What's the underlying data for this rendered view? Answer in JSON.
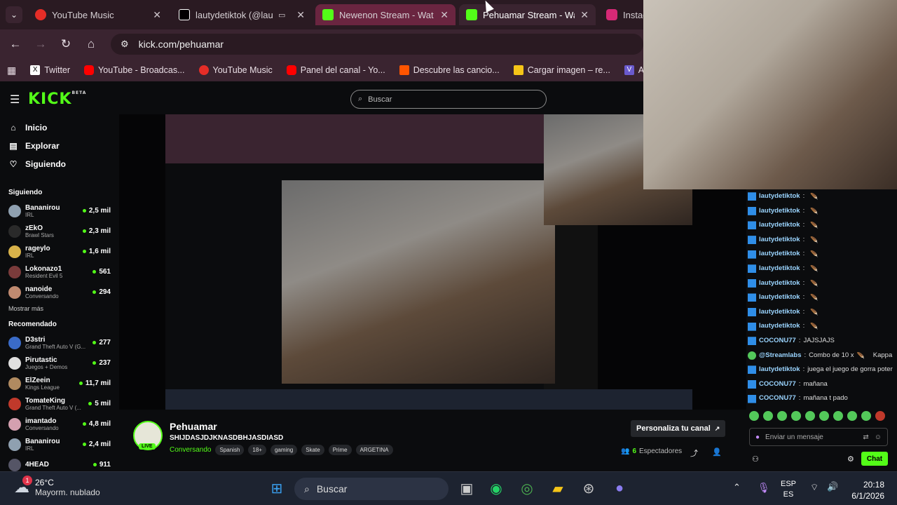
{
  "browser": {
    "tabs": [
      {
        "title": "YouTube Music",
        "icon": "youtube-music-icon",
        "color": "#e52d27"
      },
      {
        "title": "lautydetiktok (@lauty",
        "icon": "tiktok-icon",
        "color": "#ffffff"
      },
      {
        "title": "Newenon Stream - Watc",
        "icon": "kick-icon",
        "color": "#53fc18"
      },
      {
        "title": "Pehuamar Stream - Watc",
        "icon": "kick-icon",
        "color": "#53fc18"
      },
      {
        "title": "Instag",
        "icon": "instagram-icon",
        "color": "#d62976"
      }
    ],
    "url": "kick.com/pehuamar",
    "bookmarks": [
      {
        "label": "Twitter",
        "icon": "x-icon",
        "color": "#ffffff"
      },
      {
        "label": "YouTube - Broadcas...",
        "icon": "youtube-icon",
        "color": "#ff0000"
      },
      {
        "label": "YouTube Music",
        "icon": "youtube-music-icon",
        "color": "#e52d27"
      },
      {
        "label": "Panel del canal - Yo...",
        "icon": "youtube-icon",
        "color": "#ff0000"
      },
      {
        "label": "Descubre las cancio...",
        "icon": "soundcloud-icon",
        "color": "#ff5500"
      },
      {
        "label": "Cargar imagen – re...",
        "icon": "upload-icon",
        "color": "#f5c518"
      },
      {
        "label": "Aislar",
        "icon": "v-icon",
        "color": "#6a5acd"
      }
    ]
  },
  "kick": {
    "logo": "KICK",
    "logo_badge": "BETA",
    "search_placeholder": "Buscar",
    "nav": [
      {
        "label": "Inicio",
        "icon": "home-icon"
      },
      {
        "label": "Explorar",
        "icon": "browse-icon"
      },
      {
        "label": "Siguiendo",
        "icon": "heart-icon"
      }
    ],
    "following_title": "Siguiendo",
    "following": [
      {
        "name": "Bananirou",
        "category": "IRL",
        "viewers": "2,5 mil",
        "color": "#8fa0b0"
      },
      {
        "name": "zEkO",
        "category": "Brawl Stars",
        "viewers": "2,3 mil",
        "color": "#2a2a2a"
      },
      {
        "name": "rageylo",
        "category": "IRL",
        "viewers": "1,6 mil",
        "color": "#d8b24a"
      },
      {
        "name": "Lokonazo1",
        "category": "Resident Evil 5",
        "viewers": "561",
        "color": "#7a3b3b"
      },
      {
        "name": "nanoide",
        "category": "Conversando",
        "viewers": "294",
        "color": "#c08a70"
      }
    ],
    "show_more": "Mostrar más",
    "recommended_title": "Recomendado",
    "recommended": [
      {
        "name": "D3stri",
        "category": "Grand Theft Auto V (G...",
        "viewers": "277",
        "color": "#3a6bc8"
      },
      {
        "name": "Pirutastic",
        "category": "Juegos + Demos",
        "viewers": "237",
        "color": "#e0e0e0"
      },
      {
        "name": "ElZeein",
        "category": "Kings League",
        "viewers": "11,7 mil",
        "color": "#b08a60"
      },
      {
        "name": "TomateKing",
        "category": "Grand Theft Auto V (...",
        "viewers": "5 mil",
        "color": "#c0392b"
      },
      {
        "name": "imantado",
        "category": "Conversando",
        "viewers": "4,8 mil",
        "color": "#d4a0b0"
      },
      {
        "name": "Bananirou",
        "category": "IRL",
        "viewers": "2,4 mil",
        "color": "#8fa0b0"
      },
      {
        "name": "4HEAD",
        "category": "",
        "viewers": "911",
        "color": "#556"
      }
    ]
  },
  "stream": {
    "streamer": "Pehuamar",
    "title": "SHIJDASJDJKNASDBHJASDIASD",
    "category": "Conversando",
    "tags": [
      "Spanish",
      "18+",
      "gaming",
      "Skate",
      "Prime",
      "ARGETINA"
    ],
    "live_label": "LIVE",
    "customize_button": "Personaliza tu canal",
    "viewers_count": "6",
    "viewers_label": "Espectadores"
  },
  "chat": {
    "messages": [
      {
        "user": "lautydetiktok",
        "text": "",
        "color": "#9ad4ff"
      },
      {
        "user": "lautydetiktok",
        "text": "",
        "color": "#9ad4ff"
      },
      {
        "user": "lautydetiktok",
        "text": "",
        "color": "#9ad4ff"
      },
      {
        "user": "lautydetiktok",
        "text": "",
        "color": "#9ad4ff"
      },
      {
        "user": "lautydetiktok",
        "text": "",
        "color": "#9ad4ff"
      },
      {
        "user": "lautydetiktok",
        "text": "",
        "color": "#9ad4ff"
      },
      {
        "user": "lautydetiktok",
        "text": "",
        "color": "#9ad4ff"
      },
      {
        "user": "lautydetiktok",
        "text": "",
        "color": "#9ad4ff"
      },
      {
        "user": "lautydetiktok",
        "text": "",
        "color": "#9ad4ff"
      },
      {
        "user": "lautydetiktok",
        "text": "",
        "color": "#9ad4ff"
      },
      {
        "user": "COCONU77",
        "text": "JAJSJAJS",
        "color": "#9ad4ff"
      },
      {
        "user": "@Streamlabs",
        "text": "Combo de 10 x",
        "extra": "Kappa",
        "color": "#9ad4ff"
      },
      {
        "user": "lautydetiktok",
        "text": "juega el juego de gorra poter",
        "color": "#9ad4ff"
      },
      {
        "user": "COCONU77",
        "text": "mañana",
        "color": "#9ad4ff"
      },
      {
        "user": "COCONU77",
        "text": "mañana t pado",
        "color": "#9ad4ff"
      }
    ],
    "input_placeholder": "Enviar un mensaje",
    "send_button": "Chat"
  },
  "taskbar": {
    "weather_temp": "26°C",
    "weather_desc": "Mayorm. nublado",
    "weather_badge": "1",
    "search_placeholder": "Buscar",
    "lang_top": "ESP",
    "lang_bottom": "ES",
    "time": "20:18",
    "date": "6/1/2026"
  },
  "colors": {
    "kick_green": "#53fc18",
    "browser_tab_bg": "#2a1a22",
    "browser_bar_bg": "#3a2430"
  }
}
